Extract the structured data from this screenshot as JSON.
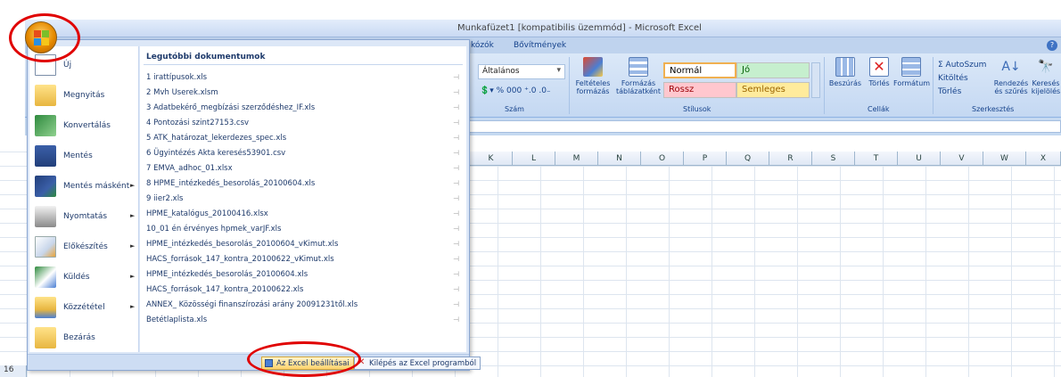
{
  "window": {
    "title": "Munkafüzet1  [kompatibilis üzemmód] - Microsoft Excel"
  },
  "ribbon": {
    "tabs": [
      "kózók",
      "Bővítmények"
    ],
    "number": {
      "format_value": "Általános",
      "percent": "%",
      "thousands": "000",
      "label": "Szám"
    },
    "styles": {
      "conditional": "Feltételes formázás",
      "table": "Formázás táblázatként",
      "normal": "Normál",
      "good": "Jó",
      "bad": "Rossz",
      "neutral": "Semleges",
      "label": "Stílusok"
    },
    "cells": {
      "insert": "Beszúrás",
      "delete": "Törlés",
      "format": "Formátum",
      "label": "Cellák"
    },
    "editing": {
      "autosum": "Σ AutoSzum",
      "fill": "Kitöltés",
      "clear": "Törlés",
      "sort": "Rendezés és szűrés",
      "find": "Keresés kijelölés",
      "label": "Szerkesztés"
    }
  },
  "grid": {
    "columns": [
      "K",
      "L",
      "M",
      "N",
      "O",
      "P",
      "Q",
      "R",
      "S",
      "T",
      "U",
      "V",
      "W",
      "X"
    ],
    "row_number": "16"
  },
  "office_menu": {
    "items": [
      {
        "label": "Új",
        "icon": "new-document-icon",
        "has_arrow": false
      },
      {
        "label": "Megnyitás",
        "icon": "open-folder-icon",
        "has_arrow": false
      },
      {
        "label": "Konvertálás",
        "icon": "convert-icon",
        "has_arrow": false
      },
      {
        "label": "Mentés",
        "icon": "save-icon",
        "has_arrow": false
      },
      {
        "label": "Mentés másként",
        "icon": "save-as-icon",
        "has_arrow": true
      },
      {
        "label": "Nyomtatás",
        "icon": "print-icon",
        "has_arrow": true
      },
      {
        "label": "Előkészítés",
        "icon": "prepare-icon",
        "has_arrow": true
      },
      {
        "label": "Küldés",
        "icon": "send-icon",
        "has_arrow": true
      },
      {
        "label": "Közzététel",
        "icon": "publish-icon",
        "has_arrow": true
      },
      {
        "label": "Bezárás",
        "icon": "close-folder-icon",
        "has_arrow": false
      }
    ],
    "recent_title": "Legutóbbi dokumentumok",
    "recent": [
      "1  irattípusok.xls",
      "2  Mvh Userek.xlsm",
      "3  Adatbekérő_megbízási szerződéshez_IF.xls",
      "4  Pontozási szint27153.csv",
      "5  ATK_határozat_lekerdezes_spec.xls",
      "6  Ügyintézés Akta keresés53901.csv",
      "7  EMVA_adhoc_01.xlsx",
      "8  HPME_intézkedés_besorolás_20100604.xls",
      "9  iier2.xls",
      "HPME_katalógus_20100416.xlsx",
      "10_01 én érvényes hpmek_varJF.xls",
      "HPME_intézkedés_besorolás_20100604_vKimut.xls",
      "HACS_források_147_kontra_20100622_vKimut.xls",
      "HPME_intézkedés_besorolás_20100604.xls",
      "HACS_források_147_kontra_20100622.xls",
      "ANNEX_ Közösségi finanszírozási arány 20091231től.xls",
      "Betétlaplista.xls"
    ],
    "options_button": "Az Excel beállításai",
    "exit_button": "Kilépés az Excel programból"
  },
  "colors": {
    "accent": "#e00000",
    "menu_bg": "#dce7f7",
    "ribbon_bg": "#c4d8f2"
  }
}
